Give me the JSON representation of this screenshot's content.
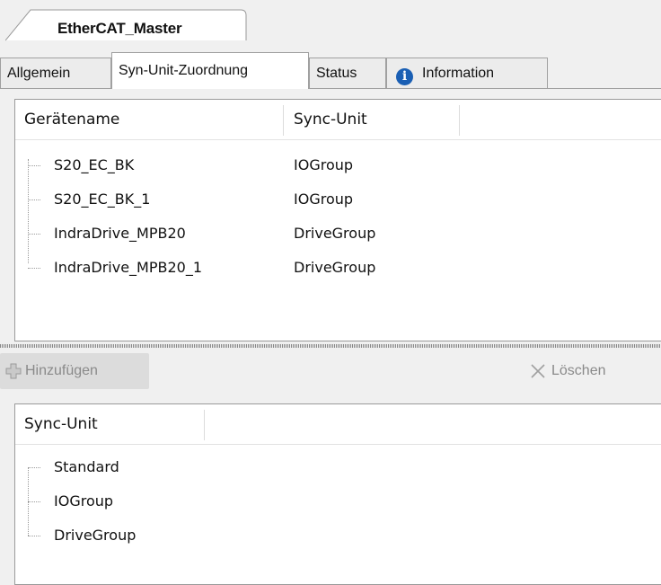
{
  "document_tab": {
    "label": "EtherCAT_Master"
  },
  "tabs": [
    {
      "label": "Allgemein",
      "active": false
    },
    {
      "label": "Syn-Unit-Zuordnung",
      "active": true
    },
    {
      "label": "Status",
      "active": false
    },
    {
      "label": "Information",
      "active": false,
      "icon": "info-icon"
    }
  ],
  "device_table": {
    "columns": [
      "Gerätename",
      "Sync-Unit"
    ],
    "rows": [
      {
        "name": "S20_EC_BK",
        "sync_unit": "IOGroup"
      },
      {
        "name": "S20_EC_BK_1",
        "sync_unit": "IOGroup"
      },
      {
        "name": "IndraDrive_MPB20",
        "sync_unit": "DriveGroup"
      },
      {
        "name": "IndraDrive_MPB20_1",
        "sync_unit": "DriveGroup"
      }
    ]
  },
  "toolbar": {
    "add_label": "Hinzufügen",
    "add_icon": "plus-icon",
    "delete_label": "Löschen",
    "delete_icon": "x-icon"
  },
  "sync_unit_table": {
    "columns": [
      "Sync-Unit"
    ],
    "rows": [
      "Standard",
      "IOGroup",
      "DriveGroup"
    ]
  }
}
